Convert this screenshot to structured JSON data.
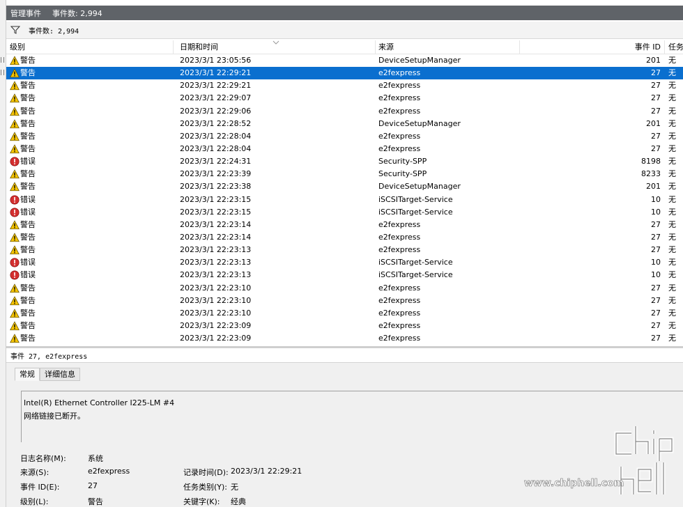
{
  "titlebar": {
    "title": "管理事件",
    "count_label": "事件数: 2,994"
  },
  "filterbar": {
    "count_label": "事件数: 2,994"
  },
  "grid": {
    "columns": {
      "level": "级别",
      "date": "日期和时间",
      "source": "来源",
      "event_id": "事件 ID",
      "task": "任务"
    },
    "rows": [
      {
        "level": "警告",
        "type": "warning",
        "date": "2023/3/1 23:05:56",
        "source": "DeviceSetupManager",
        "event_id": "201",
        "task": "无"
      },
      {
        "level": "警告",
        "type": "warning",
        "date": "2023/3/1 22:29:21",
        "source": "e2fexpress",
        "event_id": "27",
        "task": "无",
        "selected": true
      },
      {
        "level": "警告",
        "type": "warning",
        "date": "2023/3/1 22:29:21",
        "source": "e2fexpress",
        "event_id": "27",
        "task": "无"
      },
      {
        "level": "警告",
        "type": "warning",
        "date": "2023/3/1 22:29:07",
        "source": "e2fexpress",
        "event_id": "27",
        "task": "无"
      },
      {
        "level": "警告",
        "type": "warning",
        "date": "2023/3/1 22:29:06",
        "source": "e2fexpress",
        "event_id": "27",
        "task": "无"
      },
      {
        "level": "警告",
        "type": "warning",
        "date": "2023/3/1 22:28:52",
        "source": "DeviceSetupManager",
        "event_id": "201",
        "task": "无"
      },
      {
        "level": "警告",
        "type": "warning",
        "date": "2023/3/1 22:28:04",
        "source": "e2fexpress",
        "event_id": "27",
        "task": "无"
      },
      {
        "level": "警告",
        "type": "warning",
        "date": "2023/3/1 22:28:04",
        "source": "e2fexpress",
        "event_id": "27",
        "task": "无"
      },
      {
        "level": "错误",
        "type": "error",
        "date": "2023/3/1 22:24:31",
        "source": "Security-SPP",
        "event_id": "8198",
        "task": "无"
      },
      {
        "level": "警告",
        "type": "warning",
        "date": "2023/3/1 22:23:39",
        "source": "Security-SPP",
        "event_id": "8233",
        "task": "无"
      },
      {
        "level": "警告",
        "type": "warning",
        "date": "2023/3/1 22:23:38",
        "source": "DeviceSetupManager",
        "event_id": "201",
        "task": "无"
      },
      {
        "level": "错误",
        "type": "error",
        "date": "2023/3/1 22:23:15",
        "source": "iSCSITarget-Service",
        "event_id": "10",
        "task": "无"
      },
      {
        "level": "错误",
        "type": "error",
        "date": "2023/3/1 22:23:15",
        "source": "iSCSITarget-Service",
        "event_id": "10",
        "task": "无"
      },
      {
        "level": "警告",
        "type": "warning",
        "date": "2023/3/1 22:23:14",
        "source": "e2fexpress",
        "event_id": "27",
        "task": "无"
      },
      {
        "level": "警告",
        "type": "warning",
        "date": "2023/3/1 22:23:14",
        "source": "e2fexpress",
        "event_id": "27",
        "task": "无"
      },
      {
        "level": "警告",
        "type": "warning",
        "date": "2023/3/1 22:23:13",
        "source": "e2fexpress",
        "event_id": "27",
        "task": "无"
      },
      {
        "level": "错误",
        "type": "error",
        "date": "2023/3/1 22:23:13",
        "source": "iSCSITarget-Service",
        "event_id": "10",
        "task": "无"
      },
      {
        "level": "错误",
        "type": "error",
        "date": "2023/3/1 22:23:13",
        "source": "iSCSITarget-Service",
        "event_id": "10",
        "task": "无"
      },
      {
        "level": "警告",
        "type": "warning",
        "date": "2023/3/1 22:23:10",
        "source": "e2fexpress",
        "event_id": "27",
        "task": "无"
      },
      {
        "level": "警告",
        "type": "warning",
        "date": "2023/3/1 22:23:10",
        "source": "e2fexpress",
        "event_id": "27",
        "task": "无"
      },
      {
        "level": "警告",
        "type": "warning",
        "date": "2023/3/1 22:23:10",
        "source": "e2fexpress",
        "event_id": "27",
        "task": "无"
      },
      {
        "level": "警告",
        "type": "warning",
        "date": "2023/3/1 22:23:09",
        "source": "e2fexpress",
        "event_id": "27",
        "task": "无"
      },
      {
        "level": "警告",
        "type": "warning",
        "date": "2023/3/1 22:23:09",
        "source": "e2fexpress",
        "event_id": "27",
        "task": "无"
      }
    ]
  },
  "summary": {
    "text": "事件 27, e2fexpress"
  },
  "detail": {
    "tabs": [
      "常规",
      "详细信息"
    ],
    "message_line1": "Intel(R) Ethernet Controller I225-LM #4",
    "message_line2": "网络链接已断开。",
    "props": {
      "log_name_label": "日志名称(M):",
      "log_name_value": "系统",
      "source_label": "来源(S):",
      "source_value": "e2fexpress",
      "logged_label": "记录时间(D):",
      "logged_value": "2023/3/1 22:29:21",
      "event_id_label": "事件 ID(E):",
      "event_id_value": "27",
      "task_label": "任务类别(Y):",
      "task_value": "无",
      "level_label": "级别(L):",
      "level_value": "警告",
      "keywords_label": "关键字(K):",
      "keywords_value": "经典"
    }
  },
  "watermark": {
    "url": "www.chiphell.com"
  },
  "colors": {
    "selection": "#0a6fcf",
    "titlebar": "#5f6368",
    "warning": "#f5c400",
    "error": "#d32f2f"
  }
}
